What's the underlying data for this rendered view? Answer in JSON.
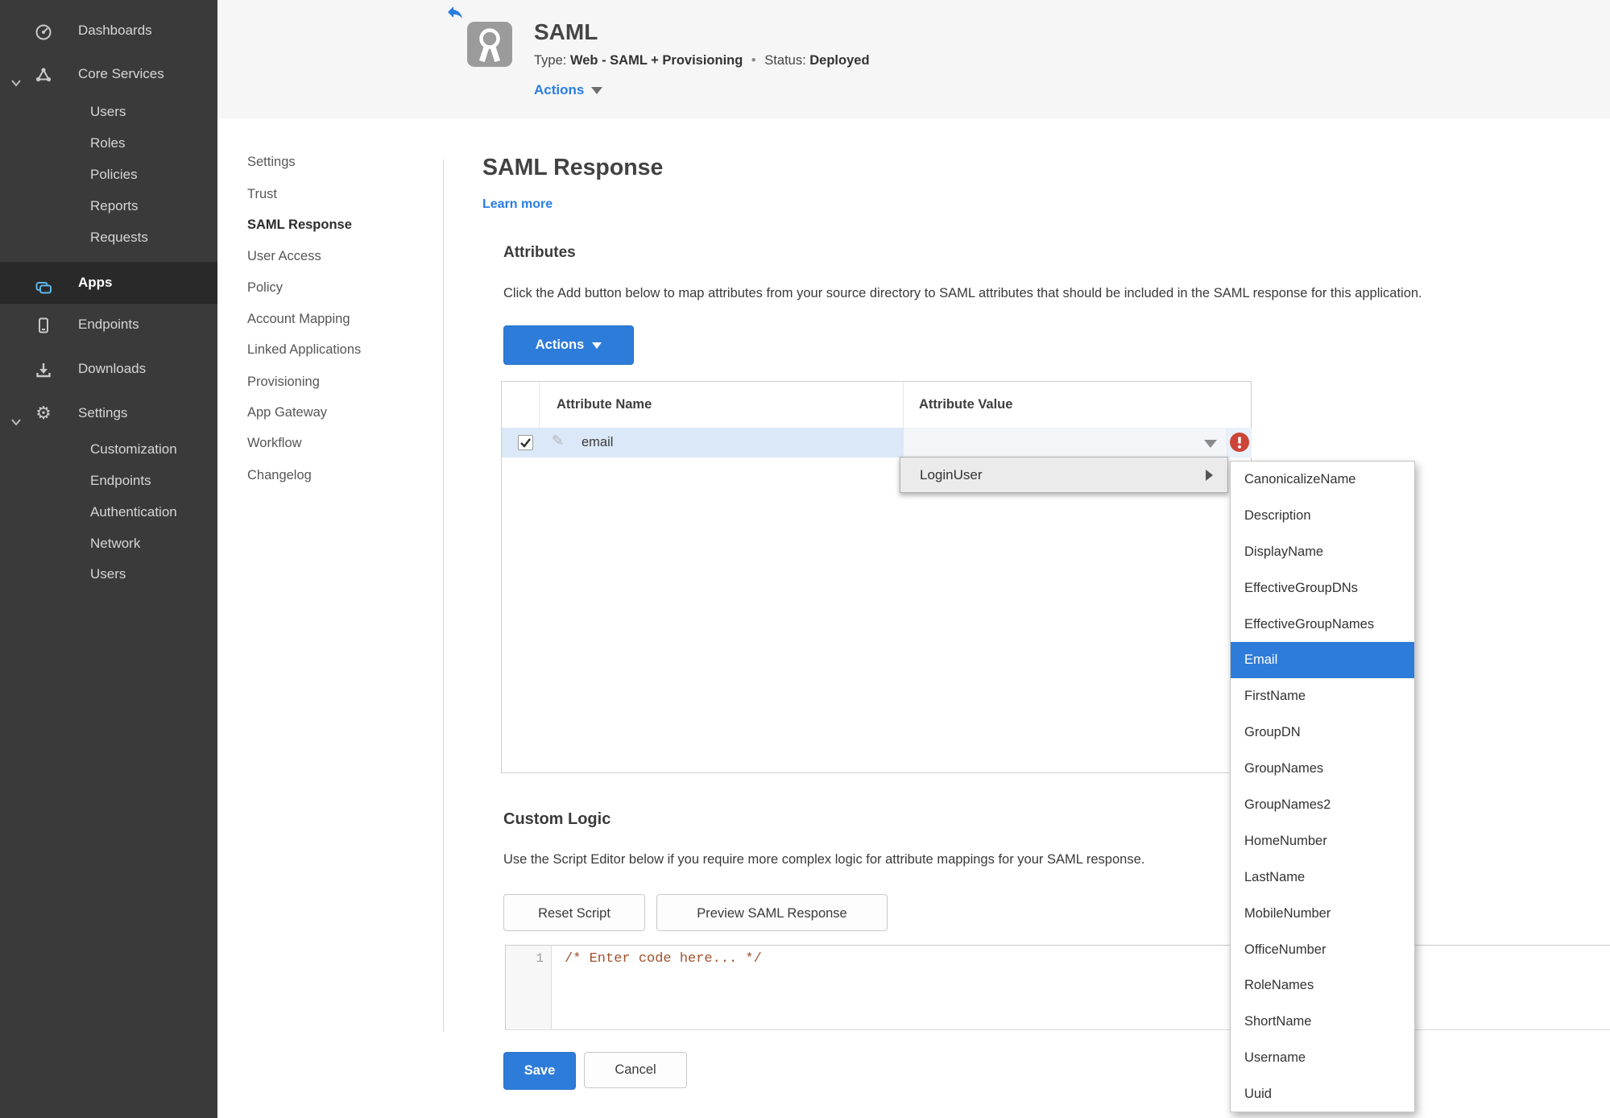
{
  "sidebar": {
    "items": [
      {
        "label": "Dashboards"
      },
      {
        "label": "Core Services"
      },
      {
        "label": "Users"
      },
      {
        "label": "Roles"
      },
      {
        "label": "Policies"
      },
      {
        "label": "Reports"
      },
      {
        "label": "Requests"
      },
      {
        "label": "Apps"
      },
      {
        "label": "Endpoints"
      },
      {
        "label": "Downloads"
      },
      {
        "label": "Settings"
      },
      {
        "label": "Customization"
      },
      {
        "label": "Endpoints"
      },
      {
        "label": "Authentication"
      },
      {
        "label": "Network"
      },
      {
        "label": "Users"
      }
    ]
  },
  "header": {
    "title": "SAML",
    "type_label": "Type:",
    "type_value": "Web - SAML + Provisioning",
    "separator": "•",
    "status_label": "Status:",
    "status_value": "Deployed",
    "actions_label": "Actions"
  },
  "subnav": {
    "items": [
      {
        "label": "Settings"
      },
      {
        "label": "Trust"
      },
      {
        "label": "SAML Response"
      },
      {
        "label": "User Access"
      },
      {
        "label": "Policy"
      },
      {
        "label": "Account Mapping"
      },
      {
        "label": "Linked Applications"
      },
      {
        "label": "Provisioning"
      },
      {
        "label": "App Gateway"
      },
      {
        "label": "Workflow"
      },
      {
        "label": "Changelog"
      }
    ],
    "active": "SAML Response"
  },
  "main": {
    "title": "SAML Response",
    "learn_more": "Learn more",
    "attributes": {
      "heading": "Attributes",
      "description": "Click the Add button below to map attributes from your source directory to SAML attributes that should be included in the SAML response for this application.",
      "actions_label": "Actions",
      "table": {
        "columns": [
          "Attribute Name",
          "Attribute Value"
        ],
        "rows": [
          {
            "name": "email",
            "value": "",
            "checked": true,
            "error": true
          }
        ]
      }
    },
    "custom_logic": {
      "heading": "Custom Logic",
      "description": "Use the Script Editor below if you require more complex logic for attribute mappings for your SAML response.",
      "reset_label": "Reset Script",
      "preview_label": "Preview SAML Response",
      "editor": {
        "line_number": "1",
        "code": "/* Enter code here... */"
      }
    },
    "footer": {
      "save_label": "Save",
      "cancel_label": "Cancel"
    }
  },
  "dropdown": {
    "trigger": "LoginUser",
    "selected": "Email",
    "items": [
      "CanonicalizeName",
      "Description",
      "DisplayName",
      "EffectiveGroupDNs",
      "EffectiveGroupNames",
      "Email",
      "FirstName",
      "GroupDN",
      "GroupNames",
      "GroupNames2",
      "HomeNumber",
      "LastName",
      "MobileNumber",
      "OfficeNumber",
      "RoleNames",
      "ShortName",
      "Username",
      "Uuid"
    ]
  },
  "colors": {
    "accent_blue": "#2e7cd9",
    "link_blue": "#2a7de1",
    "status_green": "#458a1d",
    "error_red": "#cc4538",
    "sidebar_icon_accent": "#5bb8ea"
  }
}
